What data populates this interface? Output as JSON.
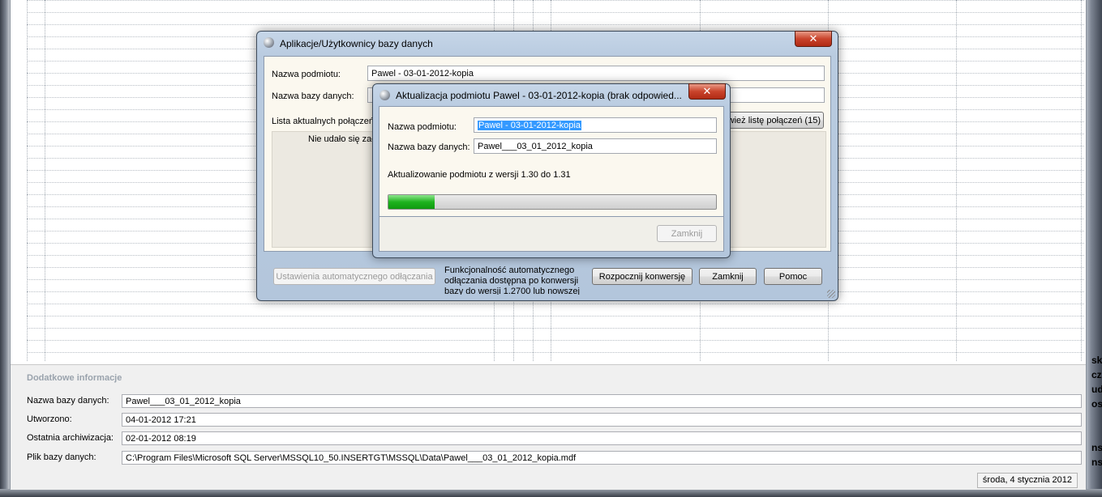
{
  "main": {
    "details": {
      "title": "Dodatkowe informacje",
      "rows": [
        {
          "label": "Nazwa bazy danych:",
          "value": "Pawel___03_01_2012_kopia"
        },
        {
          "label": "Utworzono:",
          "value": "04-01-2012 17:21"
        },
        {
          "label": "Ostatnia archiwizacja:",
          "value": "02-01-2012 08:19"
        },
        {
          "label": "Plik bazy danych:",
          "value": "C:\\Program Files\\Microsoft SQL Server\\MSSQL10_50.INSERTGT\\MSSQL\\Data\\Pawel___03_01_2012_kopia.mdf"
        }
      ]
    },
    "status_date": "środa, 4 stycznia 2012",
    "right_snippets": [
      "sko",
      "cz",
      "ud",
      "os",
      "ns",
      "ns"
    ]
  },
  "app_dialog": {
    "title": "Aplikacje/Użytkownicy bazy danych",
    "close_label": "✕",
    "entity_label": "Nazwa podmiotu:",
    "entity_value": "Pawel - 03-01-2012-kopia",
    "db_label": "Nazwa bazy danych:",
    "connections_label": "Lista aktualnych połączeń",
    "refresh_button": "Odśwież listę połączeń (15)",
    "error_text": "Nie udało się zała",
    "auto_disconnect_button": "Ustawienia automatycznego odłączania",
    "auto_disconnect_info": "Funkcjonalność automatycznego odłączania dostępna po konwersji bazy do wersji 1.2700 lub nowszej",
    "start_conversion_button": "Rozpocznij konwersję",
    "close_button": "Zamknij",
    "help_button": "Pomoc"
  },
  "update_dialog": {
    "title": "Aktualizacja podmiotu Pawel - 03-01-2012-kopia (brak odpowied...",
    "close_label": "✕",
    "entity_label": "Nazwa podmiotu:",
    "entity_value": "Pawel - 03-01-2012-kopia",
    "db_label": "Nazwa bazy danych:",
    "db_value": "Pawel___03_01_2012_kopia",
    "status_text": "Aktualizowanie podmiotu z wersji 1.30 do 1.31",
    "progress": 0.14,
    "close_button": "Zamknij"
  },
  "colors": {
    "progress_green": "#1fb31f",
    "close_red": "#c9432b",
    "selection_blue": "#3399ff"
  }
}
